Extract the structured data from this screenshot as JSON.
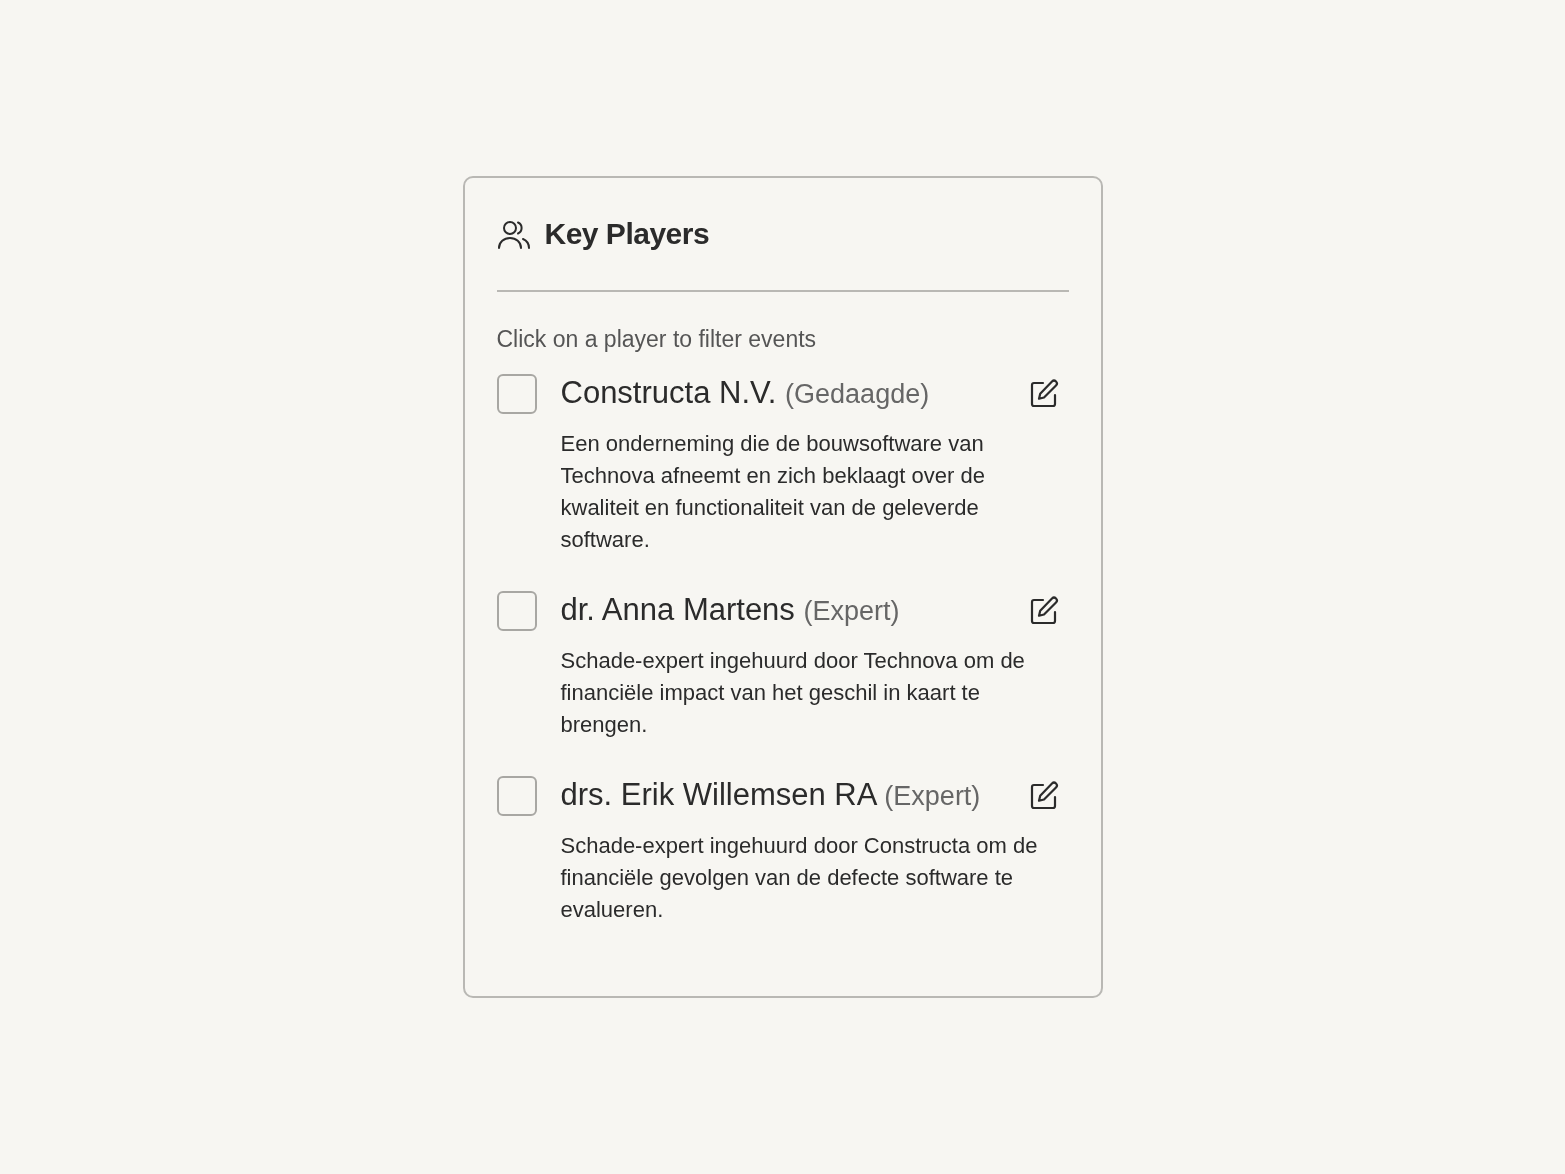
{
  "panel": {
    "title": "Key Players",
    "hint": "Click on a player to filter events"
  },
  "players": [
    {
      "name": "Constructa N.V.",
      "role": "(Gedaagde)",
      "checked": false,
      "description": "Een onderneming die de bouwsoftware van Technova afneemt en zich beklaagt over de kwaliteit en functionaliteit van de geleverde software."
    },
    {
      "name": "dr. Anna Martens",
      "role": "(Expert)",
      "checked": false,
      "description": "Schade-expert ingehuurd door Technova om de financiële impact van het geschil in kaart te brengen."
    },
    {
      "name": "drs. Erik Willemsen RA",
      "role": "(Expert)",
      "checked": false,
      "description": "Schade-expert ingehuurd door Constructa om de financiële gevolgen van de defecte software te evalueren."
    }
  ]
}
